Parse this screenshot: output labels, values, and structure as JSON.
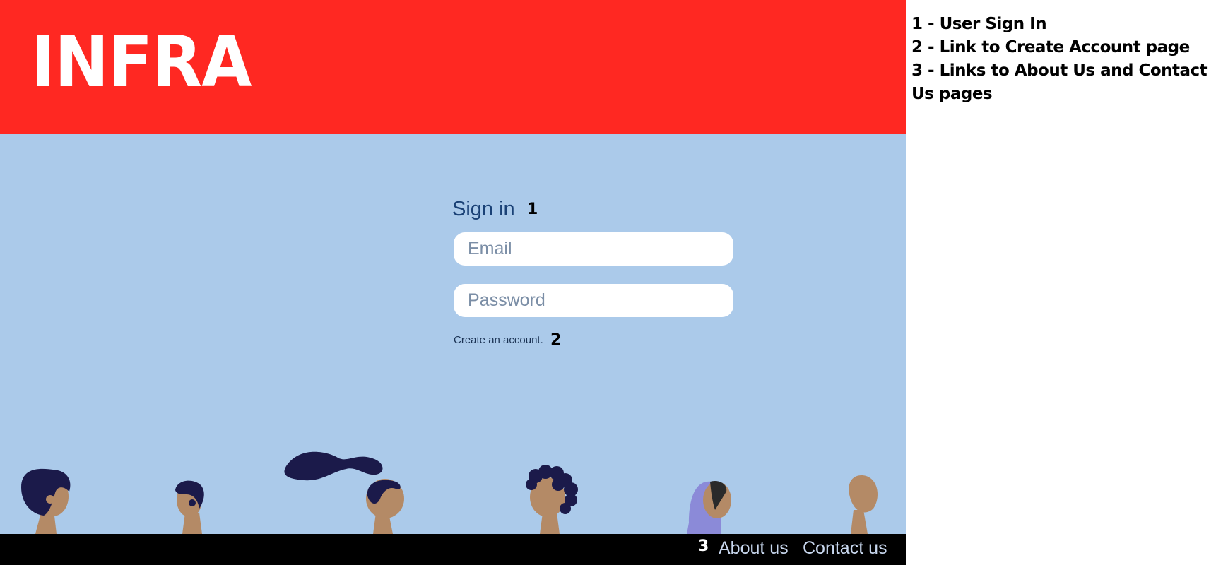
{
  "header": {
    "brand": "INFRA",
    "color": "#ff2822"
  },
  "signin": {
    "title": "Sign in",
    "email_placeholder": "Email",
    "email_value": "",
    "password_placeholder": "Password",
    "password_value": "",
    "create_account_link": "Create an account."
  },
  "footer": {
    "about_label": "About us",
    "contact_label": "Contact us"
  },
  "annotations": {
    "n1": "1",
    "n2": "2",
    "n3": "3"
  },
  "legend": {
    "items": [
      {
        "text": "1 - User Sign In"
      },
      {
        "text": "2 - Link to Create Account page"
      },
      {
        "text": "3 - Links to About Us and Contact Us pages"
      }
    ]
  },
  "illustration": {
    "name": "people-silhouettes",
    "skin": "#b48a66",
    "hair": "#1b1a4a",
    "scarf": "#8b8ad8"
  },
  "colors": {
    "background": "#abcaea",
    "footer": "#000000",
    "link": "#c8d7ee"
  }
}
